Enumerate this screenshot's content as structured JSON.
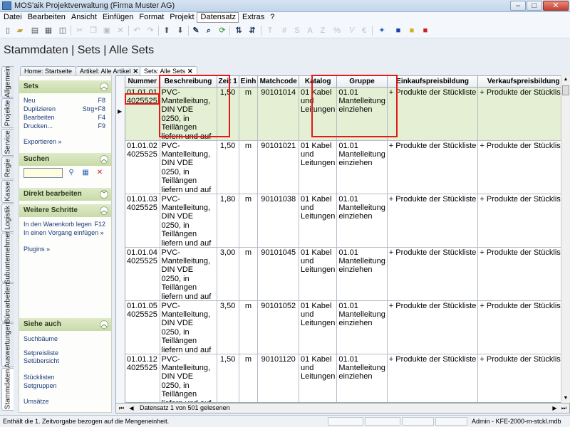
{
  "window": {
    "title": "MOS'aik Projektverwaltung (Firma Muster AG)",
    "minimize": "–",
    "maximize": "□",
    "close": "✕"
  },
  "menu": [
    "Datei",
    "Bearbeiten",
    "Ansicht",
    "Einfügen",
    "Format",
    "Projekt",
    "Datensatz",
    "Extras",
    "?"
  ],
  "toolbar": {
    "format_letters": [
      "T",
      "#",
      "S",
      "A",
      "Z",
      "%",
      "⅟",
      "€"
    ]
  },
  "page_title": "Stammdaten | Sets | Alle Sets",
  "vertical_tabs": [
    "Allgemein",
    "Projekte",
    "Service",
    "Regie",
    "Kasse",
    "Logistik",
    "Subunternehmer",
    "Büroarbeiten",
    "Auswertungen",
    "Stammdaten"
  ],
  "doc_tabs": [
    {
      "label": "Home: Startseite"
    },
    {
      "label": "Artikel: Alle Artikel",
      "close": "✕"
    },
    {
      "label": "Sets: Alle Sets",
      "close": "✕"
    }
  ],
  "side": {
    "sets": {
      "title": "Sets",
      "items": [
        {
          "label": "Neu",
          "key": "F8"
        },
        {
          "label": "Duplizieren",
          "key": "Strg+F8"
        },
        {
          "label": "Bearbeiten",
          "key": "F4"
        },
        {
          "label": "Drucken...",
          "key": "F9"
        }
      ],
      "export": "Exportieren »"
    },
    "search": {
      "title": "Suchen",
      "placeholder": ""
    },
    "direct_edit": {
      "title": "Direkt bearbeiten"
    },
    "next_steps": {
      "title": "Weitere Schritte",
      "items": [
        {
          "label": "In den Warenkorb legen",
          "key": "F12"
        },
        {
          "label": "In einen Vorgang einfügen »",
          "key": ""
        }
      ],
      "plugins": "Plugins »"
    },
    "see_also": {
      "title": "Siehe auch",
      "items": [
        "Suchbäume",
        "Setpreisliste",
        "Setübersicht",
        "Stücklisten",
        "Setgruppen",
        "Umsätze"
      ]
    }
  },
  "grid": {
    "columns": [
      "Nummer",
      "Beschreibung",
      "Zeit 1",
      "Einh",
      "Matchcode",
      "Katalog",
      "Gruppe",
      "Einkaufspreisbildung",
      "Verkaufspreisbildung"
    ],
    "rows": [
      {
        "nummer": "01.01.01",
        "artnr": "4025525",
        "beschreibung": "PVC-Mantelleitung, DIN VDE 0250, in Teillängen liefern und auf vorhandene Pritschen und Wannen verlegen, in",
        "zeit": "1,50",
        "einh": "m",
        "matchcode": "90101014",
        "katalog": "01 Kabel und Leitungen",
        "gruppe": "01.01 Mantelleitung einziehen",
        "ek": "+ Produkte der Stückliste",
        "vk": "+ Produkte der Stückliste"
      },
      {
        "nummer": "01.01.02",
        "artnr": "4025525",
        "beschreibung": "PVC-Mantelleitung, DIN VDE 0250, in Teillängen liefern und auf vorhandene Pritschen und Wannen verlegen, in",
        "zeit": "1,50",
        "einh": "m",
        "matchcode": "90101021",
        "katalog": "01 Kabel und Leitungen",
        "gruppe": "01.01 Mantelleitung einziehen",
        "ek": "+ Produkte der Stückliste",
        "vk": "+ Produkte der Stückliste"
      },
      {
        "nummer": "01.01.03",
        "artnr": "4025525",
        "beschreibung": "PVC-Mantelleitung, DIN VDE 0250, in Teillängen liefern und auf vorhandene Pritschen und Wannen verlegen, in",
        "zeit": "1,80",
        "einh": "m",
        "matchcode": "90101038",
        "katalog": "01 Kabel und Leitungen",
        "gruppe": "01.01 Mantelleitung einziehen",
        "ek": "+ Produkte der Stückliste",
        "vk": "+ Produkte der Stückliste"
      },
      {
        "nummer": "01.01.04",
        "artnr": "4025525",
        "beschreibung": "PVC-Mantelleitung, DIN VDE 0250, in Teillängen liefern und auf vorhandene Pritschen und Wannen verlegen, in",
        "zeit": "3,00",
        "einh": "m",
        "matchcode": "90101045",
        "katalog": "01 Kabel und Leitungen",
        "gruppe": "01.01 Mantelleitung einziehen",
        "ek": "+ Produkte der Stückliste",
        "vk": "+ Produkte der Stückliste"
      },
      {
        "nummer": "01.01.05",
        "artnr": "4025525",
        "beschreibung": "PVC-Mantelleitung, DIN VDE 0250, in Teillängen liefern und auf vorhandene Pritschen und Wannen verlegen, in",
        "zeit": "3,50",
        "einh": "m",
        "matchcode": "90101052",
        "katalog": "01 Kabel und Leitungen",
        "gruppe": "01.01 Mantelleitung einziehen",
        "ek": "+ Produkte der Stückliste",
        "vk": "+ Produkte der Stückliste"
      },
      {
        "nummer": "01.01.12",
        "artnr": "4025525",
        "beschreibung": "PVC-Mantelleitung, DIN VDE 0250, in Teillängen liefern und auf vorhandene Pritschen und Wannen verlegen, in",
        "zeit": "1,50",
        "einh": "m",
        "matchcode": "90101120",
        "katalog": "01 Kabel und Leitungen",
        "gruppe": "01.01 Mantelleitung einziehen",
        "ek": "+ Produkte der Stückliste",
        "vk": "+ Produkte der Stückliste"
      }
    ],
    "selected_row": 0
  },
  "navigation": {
    "text": "Datensatz 1 von 501 gelesenen"
  },
  "status": {
    "message": "Enthält die 1. Zeitvorgabe bezogen auf die Mengeneinheit.",
    "right": "Admin - KFE-2000-m-stckl.mdb"
  },
  "colors": {
    "selected_row": "#e4efd4",
    "highlight_box": "#e11a1a",
    "side_header": "#c8dba8"
  }
}
